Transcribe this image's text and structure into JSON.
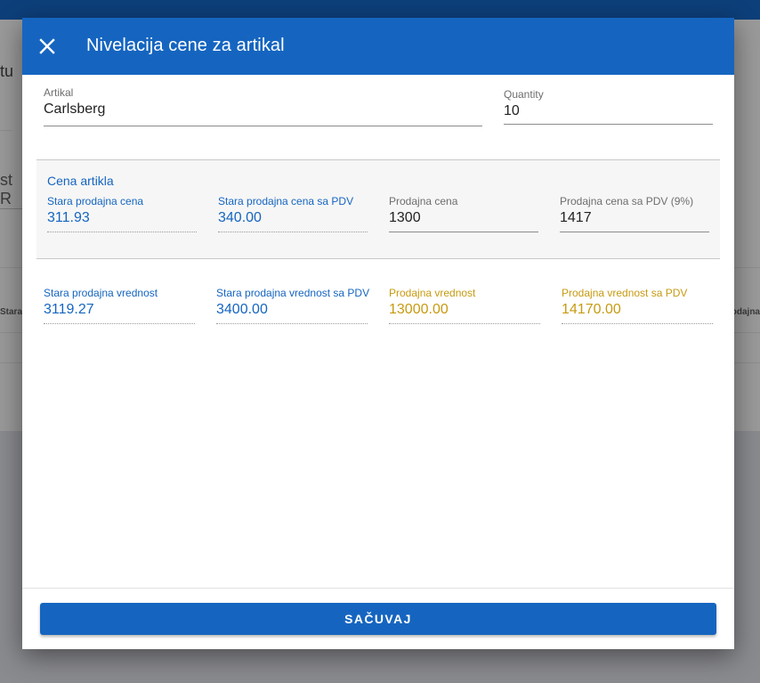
{
  "background": {
    "left_text": "tu",
    "left_input": "st R",
    "col_left": "Stara",
    "col_right": "odajna"
  },
  "dialog": {
    "title": "Nivelacija cene za artikal",
    "close_icon": "close-icon",
    "article": {
      "label": "Artikal",
      "value": "Carlsberg"
    },
    "quantity": {
      "label": "Quantity",
      "value": "10"
    },
    "price_section": {
      "title": "Cena artikla",
      "old_price": {
        "label": "Stara prodajna cena",
        "value": "311.93"
      },
      "old_price_vat": {
        "label": "Stara prodajna cena sa PDV",
        "value": "340.00"
      },
      "new_price": {
        "label": "Prodajna cena",
        "value": "1300"
      },
      "new_price_vat": {
        "label": "Prodajna cena sa PDV (9%)",
        "value": "1417"
      }
    },
    "values": {
      "old_value": {
        "label": "Stara prodajna vrednost",
        "value": "3119.27"
      },
      "old_value_vat": {
        "label": "Stara prodajna vrednost sa PDV",
        "value": "3400.00"
      },
      "new_value": {
        "label": "Prodajna vrednost",
        "value": "13000.00"
      },
      "new_value_vat": {
        "label": "Prodajna vrednost sa PDV",
        "value": "14170.00"
      }
    },
    "save_label": "SAČUVAJ"
  },
  "colors": {
    "primary": "#1565c0",
    "accent_gold": "#c79a10"
  }
}
